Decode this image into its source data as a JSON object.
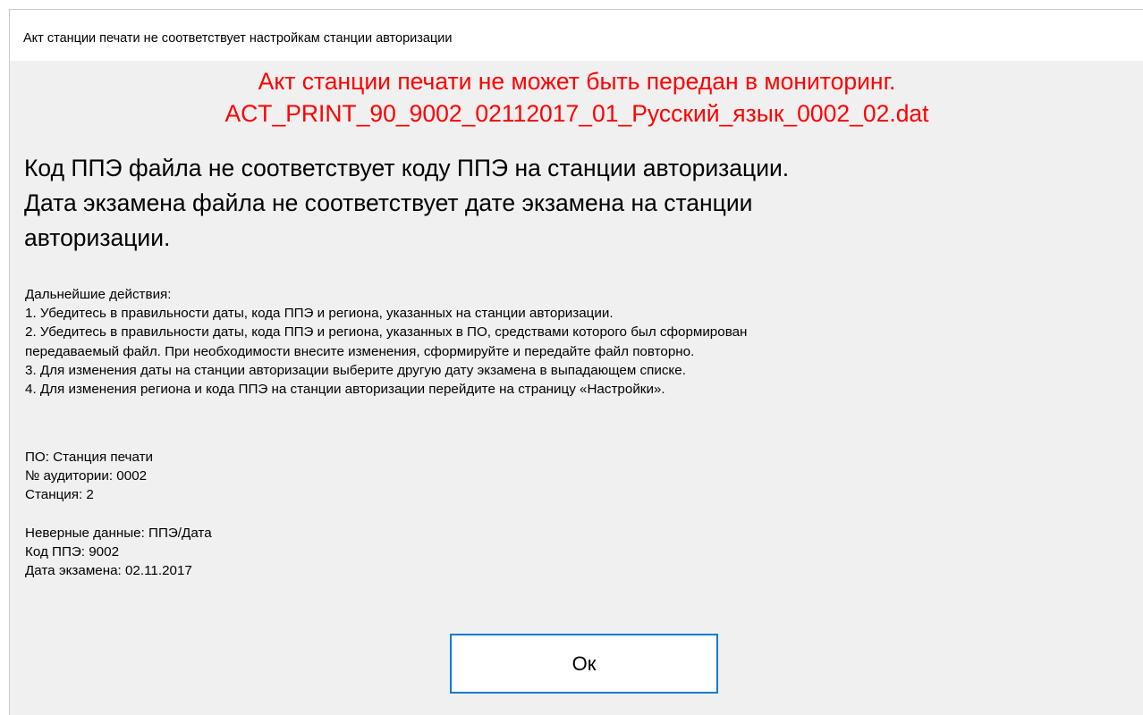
{
  "dialog": {
    "title": "Акт станции печати не соответствует настройкам станции авторизации",
    "error_heading": [
      "Акт станции печати не может быть передан в мониторинг.",
      "ACT_PRINT_90_9002_02112017_01_Русский_язык_0002_02.dat"
    ],
    "messages": [
      "Код ППЭ файла не соответствует коду ППЭ на станции авторизации.",
      "Дата экзамена файла не соответствует дате экзамена на станции",
      "авторизации."
    ],
    "next_steps": {
      "heading": "Дальнейшие действия:",
      "items": [
        "1. Убедитесь в правильности даты, кода ППЭ и региона, указанных на станции авторизации.",
        "2. Убедитесь в правильности даты, кода ППЭ и региона, указанных в ПО, средствами которого был сформирован",
        "передаваемый файл. При необходимости внесите изменения, сформируйте и передайте файл повторно.",
        "3. Для изменения даты на станции авторизации выберите другую дату экзамена в выпадающем списке.",
        "4. Для изменения региона и кода ППЭ на станции авторизации перейдите на страницу «Настройки»."
      ]
    },
    "source_info": {
      "software": "ПО: Станция печати",
      "room": "№ аудитории: 0002",
      "station": "Станция: 2"
    },
    "mismatch_info": {
      "invalid_data": "Неверные данные: ППЭ/Дата",
      "ppe_code": "Код ППЭ: 9002",
      "exam_date": "Дата экзамена: 02.11.2017"
    },
    "ok_label": "Ок"
  },
  "colors": {
    "error_text": "#ff0000",
    "button_border": "#0a7bd6",
    "dialog_bg": "#f0f0f0",
    "titlebar_bg": "#ffffff"
  }
}
